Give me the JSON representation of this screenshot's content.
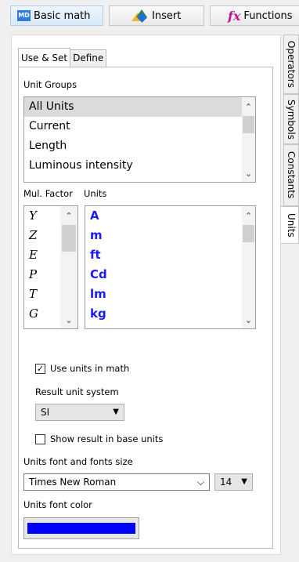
{
  "toolbar": {
    "basic_math_icon": "MD",
    "basic_math_label": "Basic math",
    "insert_label": "Insert",
    "functions_icon": "fx",
    "functions_label": "Functions"
  },
  "side_tabs": [
    "Operators",
    "Symbols",
    "Constants",
    "Units"
  ],
  "tabs": {
    "use_set": "Use & Set",
    "define": "Define"
  },
  "unit_groups": {
    "label": "Unit Groups",
    "items": [
      "All Units",
      "Current",
      "Length",
      "Luminous intensity"
    ],
    "selected": "All Units"
  },
  "mul_factor": {
    "label": "Mul. Factor",
    "items": [
      "Y",
      "Z",
      "E",
      "P",
      "T",
      "G"
    ]
  },
  "units": {
    "label": "Units",
    "items": [
      "A",
      "m",
      "ft",
      "Cd",
      "lm",
      "kg"
    ]
  },
  "use_units_in_math": {
    "label": "Use units in math",
    "checked": true
  },
  "result_unit_system": {
    "label": "Result unit system",
    "value": "SI"
  },
  "show_result_in_base_units": {
    "label": "Show result in base units",
    "checked": false
  },
  "units_font": {
    "label": "Units font and fonts size",
    "font": "Times New Roman",
    "size": "14"
  },
  "units_font_color": {
    "label": "Units font color",
    "color": "#0000ff"
  },
  "icons": {
    "checkmark": "✓",
    "caret_down": "▼",
    "chevron_down": "⌵",
    "arrow_up": "⌃",
    "arrow_down": "⌄"
  }
}
